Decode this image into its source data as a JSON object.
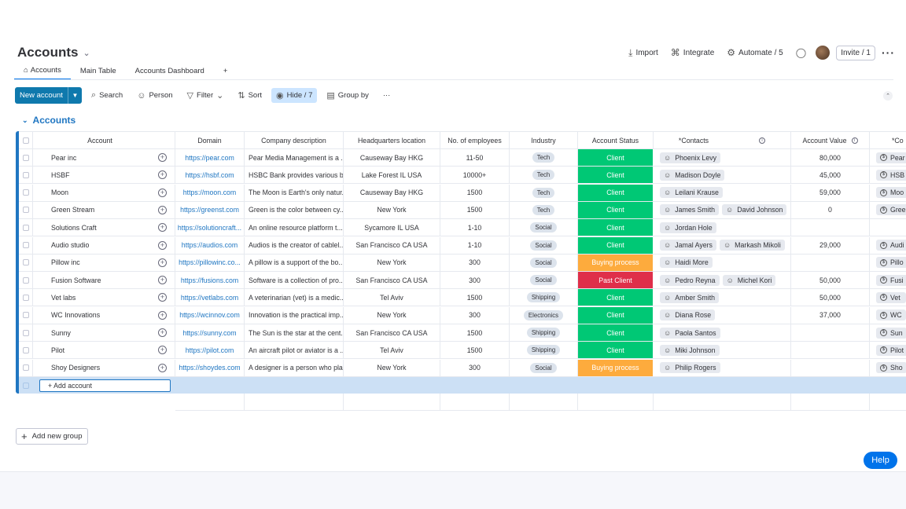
{
  "header": {
    "title": "Accounts",
    "import_label": "Import",
    "integrate_label": "Integrate",
    "automate_label": "Automate / 5",
    "invite_label": "Invite / 1"
  },
  "tabs": [
    {
      "label": "Accounts"
    },
    {
      "label": "Main Table"
    },
    {
      "label": "Accounts Dashboard"
    },
    {
      "label": "+"
    }
  ],
  "toolbar": {
    "new_label": "New account",
    "search_label": "Search",
    "person_label": "Person",
    "filter_label": "Filter",
    "sort_label": "Sort",
    "hide_label": "Hide / 7",
    "groupby_label": "Group by"
  },
  "group": {
    "title": "Accounts"
  },
  "columns": {
    "account": "Account",
    "domain": "Domain",
    "description": "Company description",
    "hq": "Headquarters location",
    "employees": "No. of employees",
    "industry": "Industry",
    "status": "Account Status",
    "contacts": "*Contacts",
    "value": "Account Value",
    "companies": "*Co"
  },
  "rows": [
    {
      "account": "Pear inc",
      "domain": "https://pear.com",
      "description": "Pear Media Management is a ...",
      "hq": "Causeway Bay HKG",
      "employees": "11-50",
      "industry": "Tech",
      "status": "Client",
      "c1": "Phoenix Levy",
      "c2": "",
      "value": "80,000",
      "company": "Pear"
    },
    {
      "account": "HSBF",
      "domain": "https://hsbf.com",
      "description": "HSBC Bank provides various b...",
      "hq": "Lake Forest IL USA",
      "employees": "10000+",
      "industry": "Tech",
      "status": "Client",
      "c1": "Madison Doyle",
      "c2": "",
      "value": "45,000",
      "company": "HSB"
    },
    {
      "account": "Moon",
      "domain": "https://moon.com",
      "description": "The Moon is Earth's only natur...",
      "hq": "Causeway Bay HKG",
      "employees": "1500",
      "industry": "Tech",
      "status": "Client",
      "c1": "Leilani Krause",
      "c2": "",
      "value": "59,000",
      "company": "Moo"
    },
    {
      "account": "Green Stream",
      "domain": "https://greenst.com",
      "description": "Green is the color between cy...",
      "hq": "New York",
      "employees": "1500",
      "industry": "Tech",
      "status": "Client",
      "c1": "James Smith",
      "c2": "David Johnson",
      "value": "0",
      "company": "Gree"
    },
    {
      "account": "Solutions Craft",
      "domain": "https://solutioncraft...",
      "description": "An online resource platform t...",
      "hq": "Sycamore IL USA",
      "employees": "1-10",
      "industry": "Social",
      "status": "Client",
      "c1": "Jordan Hole",
      "c2": "",
      "value": "",
      "company": ""
    },
    {
      "account": "Audio studio",
      "domain": "https://audios.com",
      "description": "Audios is the creator of cablel...",
      "hq": "San Francisco CA USA",
      "employees": "1-10",
      "industry": "Social",
      "status": "Client",
      "c1": "Jamal Ayers",
      "c2": "Markash Mikoli",
      "value": "29,000",
      "company": "Audi"
    },
    {
      "account": "Pillow inc",
      "domain": "https://pillowinc.co...",
      "description": "A pillow is a support of the bo...",
      "hq": "New York",
      "employees": "300",
      "industry": "Social",
      "status": "Buying process",
      "c1": "Haidi More",
      "c2": "",
      "value": "",
      "company": "Pillo"
    },
    {
      "account": "Fusion Software",
      "domain": "https://fusions.com",
      "description": "Software is a collection of pro...",
      "hq": "San Francisco CA USA",
      "employees": "300",
      "industry": "Social",
      "status": "Past Client",
      "c1": "Pedro Reyna",
      "c2": "Michel Kori",
      "value": "50,000",
      "company": "Fusi"
    },
    {
      "account": "Vet labs",
      "domain": "https://vetlabs.com",
      "description": "A veterinarian (vet) is a medic...",
      "hq": "Tel Aviv",
      "employees": "1500",
      "industry": "Shipping",
      "status": "Client",
      "c1": "Amber Smith",
      "c2": "",
      "value": "50,000",
      "company": "Vet"
    },
    {
      "account": "WC Innovations",
      "domain": "https://wcinnov.com",
      "description": "Innovation is the practical imp...",
      "hq": "New York",
      "employees": "300",
      "industry": "Electronics",
      "status": "Client",
      "c1": "Diana Rose",
      "c2": "",
      "value": "37,000",
      "company": "WC"
    },
    {
      "account": "Sunny",
      "domain": "https://sunny.com",
      "description": "The Sun is the star at the cent...",
      "hq": "San Francisco CA USA",
      "employees": "1500",
      "industry": "Shipping",
      "status": "Client",
      "c1": "Paola Santos",
      "c2": "",
      "value": "",
      "company": "Sun"
    },
    {
      "account": "Pilot",
      "domain": "https://pilot.com",
      "description": "An aircraft pilot or aviator is a ...",
      "hq": "Tel Aviv",
      "employees": "1500",
      "industry": "Shipping",
      "status": "Client",
      "c1": "Miki Johnson",
      "c2": "",
      "value": "",
      "company": "Pilot"
    },
    {
      "account": "Shoy Designers",
      "domain": "https://shoydes.com",
      "description": "A designer is a person who pla...",
      "hq": "New York",
      "employees": "300",
      "industry": "Social",
      "status": "Buying process",
      "c1": "Philip Rogers",
      "c2": "",
      "value": "",
      "company": "Sho"
    }
  ],
  "add_account_label": "+ Add account",
  "add_group_label": "Add new group",
  "help_label": "Help",
  "status_colors": {
    "Client": "#00c875",
    "Buying process": "#fdab3d",
    "Past Client": "#df2f4a"
  },
  "icons": [
    "chevron-down-icon",
    "import-icon",
    "integrate-icon",
    "automate-icon",
    "chat-icon",
    "home-icon",
    "search-icon",
    "person-icon",
    "filter-icon",
    "sort-icon",
    "eye-icon",
    "group-icon",
    "person-chip-icon",
    "company-icon",
    "info-icon",
    "add-update-icon"
  ]
}
